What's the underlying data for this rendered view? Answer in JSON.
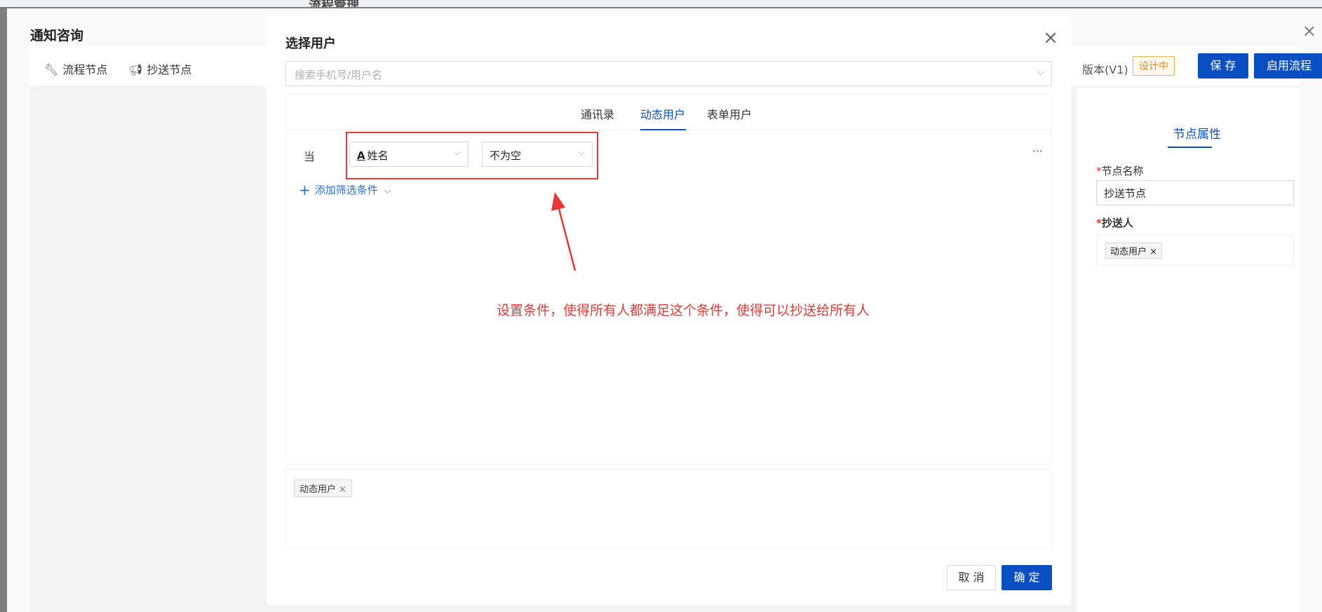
{
  "background": {
    "breadcrumb": "流程管理",
    "drawer_title": "通知咨询",
    "toolbar": {
      "node_flow": "流程节点",
      "node_cc": "抄送节点",
      "version": "版本(V1)",
      "status": "设计中",
      "save": "保 存",
      "enable": "启用流程"
    },
    "right_panel": {
      "tab": "节点属性",
      "name_label": "节点名称",
      "name_value": "抄送节点",
      "cc_label": "抄送人",
      "cc_tag": "动态用户"
    }
  },
  "modal": {
    "title": "选择用户",
    "search_placeholder": "搜索手机号/用户名",
    "tabs": [
      "通讯录",
      "动态用户",
      "表单用户"
    ],
    "active_tab": "动态用户",
    "condition": {
      "when": "当",
      "field": "姓名",
      "operator": "不为空",
      "more": "···"
    },
    "add_filter": "添加筛选条件",
    "annotation": "设置条件，使得所有人都满足这个条件，使得可以抄送给所有人",
    "selected_tag": "动态用户",
    "cancel": "取 消",
    "confirm": "确 定"
  },
  "colors": {
    "primary": "#0a4fc2",
    "annotation": "#e53935",
    "warning": "#e08a1e"
  }
}
